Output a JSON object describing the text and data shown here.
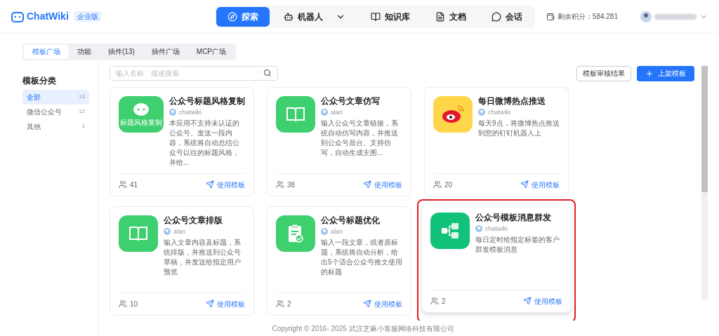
{
  "header": {
    "logo": "ChatWiki",
    "edition": "企业版",
    "nav": [
      {
        "label": "探索",
        "selected": true,
        "kind": "explore",
        "dropdown": false
      },
      {
        "label": "机器人",
        "selected": false,
        "kind": "robot",
        "dropdown": true
      },
      {
        "label": "知识库",
        "selected": false,
        "kind": "book",
        "dropdown": false
      },
      {
        "label": "文档",
        "selected": false,
        "kind": "doc",
        "dropdown": false
      },
      {
        "label": "会话",
        "selected": false,
        "kind": "chat",
        "dropdown": false
      }
    ],
    "points": "剩余积分：584.281"
  },
  "tabs": [
    {
      "label": "模板广场",
      "selected": true
    },
    {
      "label": "功能",
      "selected": false
    },
    {
      "label": "插件(13)",
      "selected": false
    },
    {
      "label": "插件广场",
      "selected": false
    },
    {
      "label": "MCP广场",
      "selected": false
    }
  ],
  "sidebar": {
    "title": "模板分类",
    "items": [
      {
        "label": "全部",
        "count": "13",
        "selected": true
      },
      {
        "label": "微信公众号",
        "count": "12",
        "selected": false
      },
      {
        "label": "其他",
        "count": "1",
        "selected": false
      }
    ]
  },
  "search": {
    "placeholder": "输入名称、描述搜索"
  },
  "buttons": {
    "review": "模板审核结果",
    "publish": "上架模板"
  },
  "cards": [
    {
      "title": "公众号标题风格复制",
      "author": "chatwiki",
      "description": "本应用不支持未认证的公众号。发送一段内容，系统将自动总结公众号以往的标题风格，并给...",
      "uses": "41",
      "action": "使用模板",
      "kind": "wechat",
      "icon_label": "标题风格复制",
      "highlighted": false
    },
    {
      "title": "公众号文章仿写",
      "author": "alan",
      "description": "输入公众号文章链接，系统自动仿写内容，并推送到公众号后台。支持仿写，自动生成主图...",
      "uses": "38",
      "action": "使用模板",
      "kind": "book",
      "highlighted": false
    },
    {
      "title": "每日微博热点推送",
      "author": "chatwiki",
      "description": "每天9点，将微博热点推送到您的钉钉机器人上",
      "uses": "20",
      "action": "使用模板",
      "kind": "weibo",
      "highlighted": false
    },
    {
      "title": "公众号文章排版",
      "author": "alan",
      "description": "输入文章内容及标题，系统排版，并推送到公众号草稿，并发送给指定用户预览",
      "uses": "10",
      "action": "使用模板",
      "kind": "book",
      "highlighted": false
    },
    {
      "title": "公众号标题优化",
      "author": "alan",
      "description": "输入一段文章，或者原标题，系统将自动分析，给出5个适合公众号推文使用的标题",
      "uses": "2",
      "action": "使用模板",
      "kind": "clipboard",
      "highlighted": false
    },
    {
      "title": "公众号模板消息群发",
      "author": "chatwiki",
      "description": "每日定时给指定标签的客户群发模板消息",
      "uses": "2",
      "action": "使用模板",
      "kind": "flow",
      "highlighted": true
    }
  ],
  "footer": "Copyright © 2016- 2025 武汉芝麻小客服网络科技有限公司"
}
